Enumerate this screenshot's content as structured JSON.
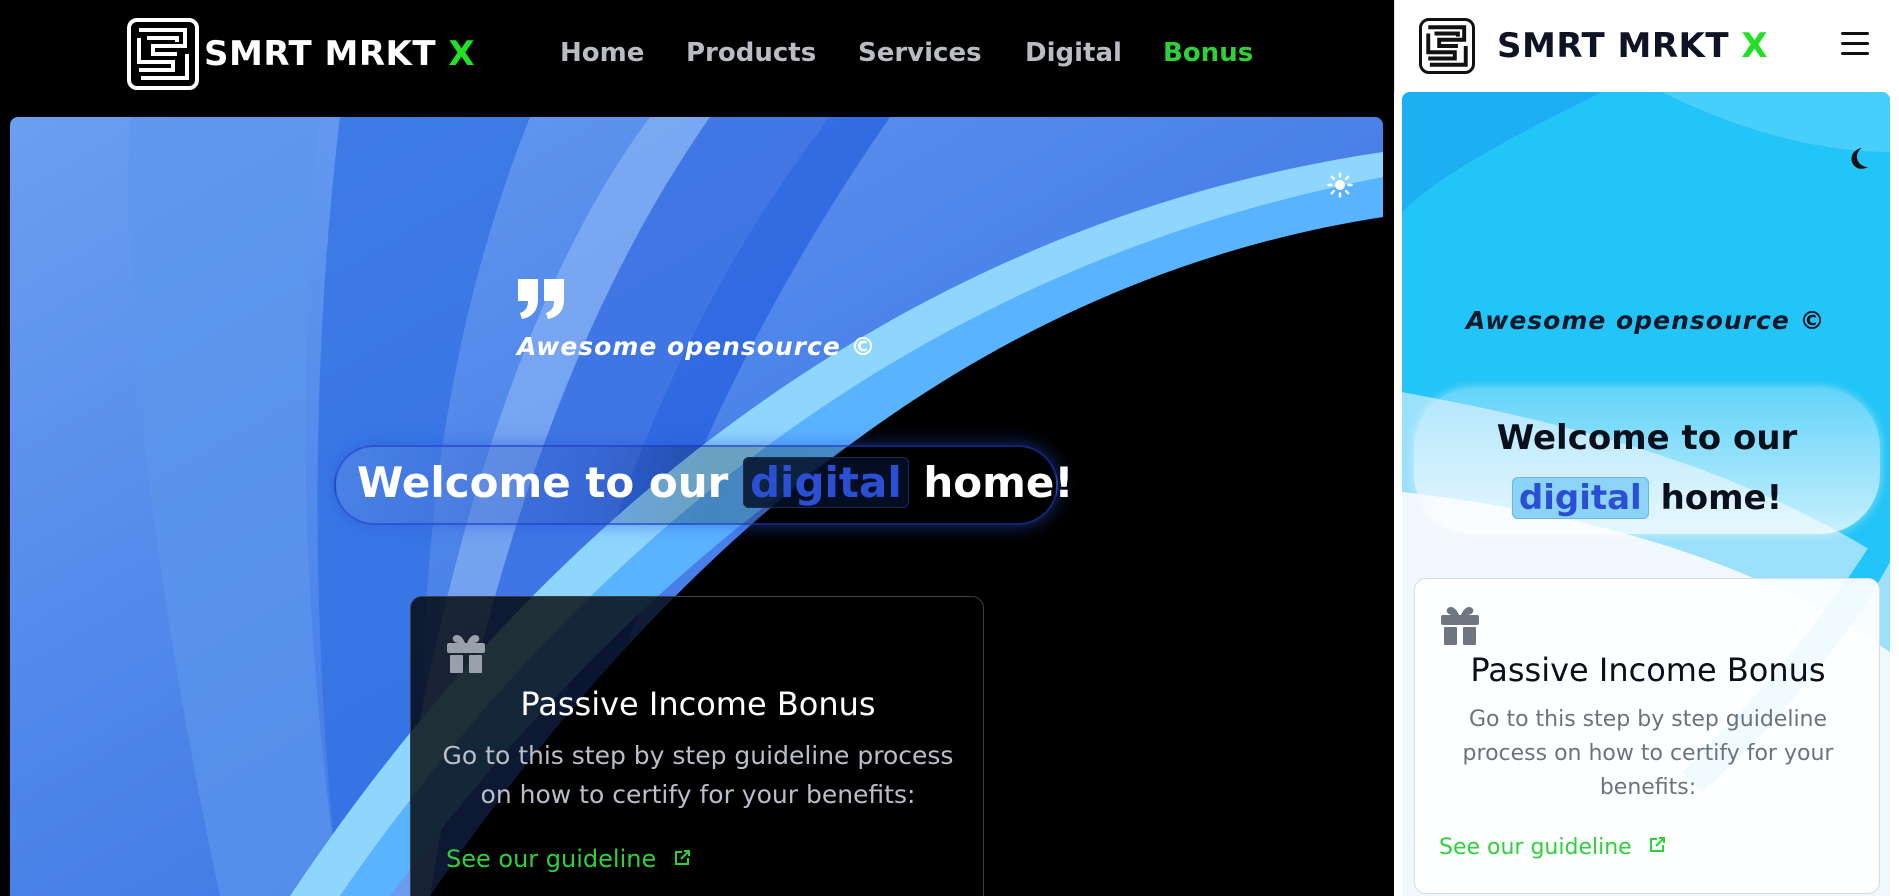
{
  "brand": {
    "name": "SMRT MRKT ",
    "x": "X",
    "accent": "#22e024"
  },
  "nav": {
    "items": [
      {
        "label": "Home"
      },
      {
        "label": "Products"
      },
      {
        "label": "Services"
      },
      {
        "label": "Digital"
      },
      {
        "label": "Bonus",
        "color": "#2ed13a"
      }
    ]
  },
  "hero": {
    "tagline": "Awesome opensource ©",
    "welcome_pre": "Welcome to our",
    "welcome_highlight": "digital",
    "welcome_post": "home!"
  },
  "card": {
    "title": "Passive Income Bonus",
    "body": "Go to this step by step guideline process on how to certify for your benefits:",
    "body_mobile_1": "Go to this step by step guideline",
    "body_mobile_2": "process on how to certify for your",
    "body_mobile_3": "benefits:",
    "body_desk_1": "Go to this step by step guideline process",
    "body_desk_2": "on how to certify for your benefits:",
    "link_label": "See our guideline"
  },
  "icons": {
    "logo": "logo-icon",
    "theme_desktop": "sun-icon",
    "theme_mobile": "moon-icon",
    "menu": "hamburger-icon",
    "gift": "gift-icon",
    "external": "external-link-icon",
    "quote": "quote-icon"
  },
  "colors": {
    "link_green": "#2ed13a",
    "digital_blue": "#2b4fd3",
    "sky": "#23c4f7"
  }
}
